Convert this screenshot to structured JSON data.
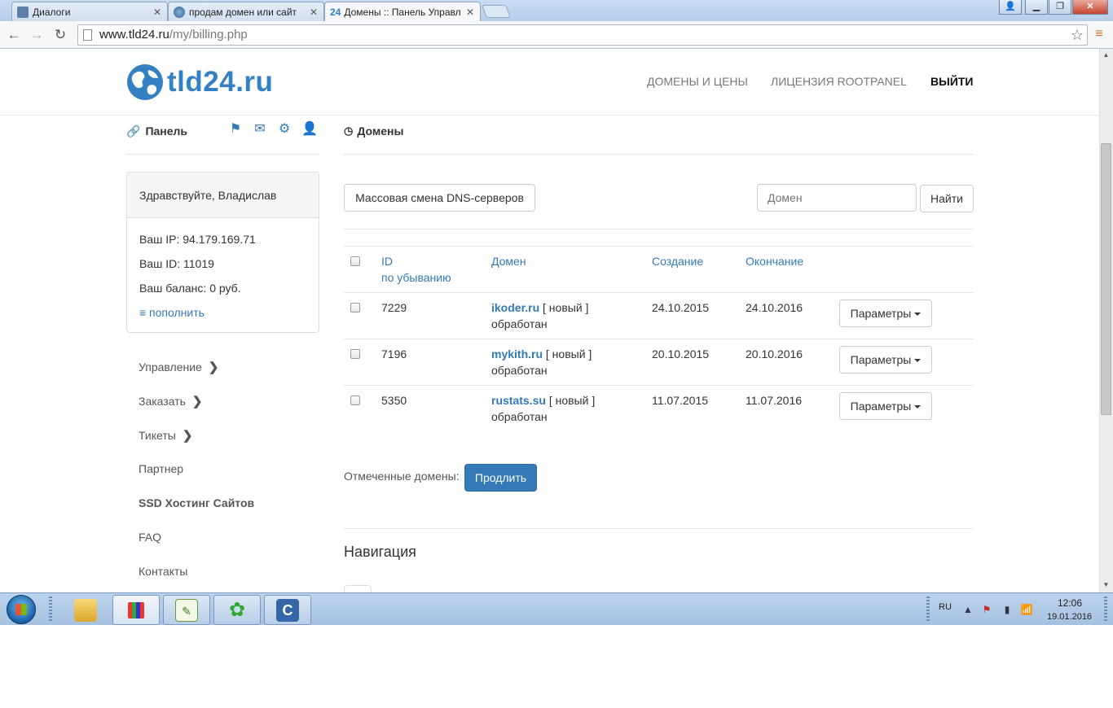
{
  "browser": {
    "tabs": [
      {
        "title": "Диалоги",
        "active": false
      },
      {
        "title": "продам домен или сайт",
        "active": false
      },
      {
        "title": "Домены :: Панель Управл",
        "active": true
      }
    ],
    "url_host": "www.tld24.ru",
    "url_path": "/my/billing.php"
  },
  "site": {
    "logo_text": "tld24.ru",
    "nav": [
      {
        "label": "ДОМЕНЫ И ЦЕНЫ"
      },
      {
        "label": "ЛИЦЕНЗИЯ ROOTPANEL"
      },
      {
        "label": "ВЫЙТИ"
      }
    ]
  },
  "sidebar": {
    "title": "Панель",
    "greeting": "Здравствуйте, Владислав",
    "ip_line": "Ваш IP: 94.179.169.71",
    "id_line": "Ваш ID: 11019",
    "balance_line": "Ваш баланс: 0 руб.",
    "topup_label": "≡ пополнить",
    "menu": [
      {
        "label": "Управление",
        "has_children": true
      },
      {
        "label": "Заказать",
        "has_children": true
      },
      {
        "label": "Тикеты",
        "has_children": true
      },
      {
        "label": "Партнер",
        "has_children": false
      },
      {
        "label": "SSD Хостинг Сайтов",
        "has_children": false
      },
      {
        "label": "FAQ",
        "has_children": false
      },
      {
        "label": "Контакты",
        "has_children": false
      }
    ]
  },
  "main": {
    "title": "Домены",
    "mass_dns_button": "Массовая смена DNS-серверов",
    "search_placeholder": "Домен",
    "search_button": "Найти",
    "table": {
      "col_id": "ID",
      "col_id_sort": "по убыванию",
      "col_domain": "Домен",
      "col_created": "Создание",
      "col_expires": "Окончание",
      "rows": [
        {
          "id": "7229",
          "domain": "ikoder.ru",
          "tag": "[ новый ]",
          "status": "обработан",
          "created": "24.10.2015",
          "expires": "24.10.2016",
          "action": "Параметры"
        },
        {
          "id": "7196",
          "domain": "mykith.ru",
          "tag": "[ новый ]",
          "status": "обработан",
          "created": "20.10.2015",
          "expires": "20.10.2016",
          "action": "Параметры"
        },
        {
          "id": "5350",
          "domain": "rustats.su",
          "tag": "[ новый ]",
          "status": "обработан",
          "created": "11.07.2015",
          "expires": "11.07.2016",
          "action": "Параметры"
        }
      ]
    },
    "marked_label": "Отмеченные домены:",
    "renew_button": "Продлить",
    "nav_title": "Навигация"
  },
  "taskbar": {
    "lang": "RU",
    "time": "12:06",
    "date": "19.01.2016"
  }
}
